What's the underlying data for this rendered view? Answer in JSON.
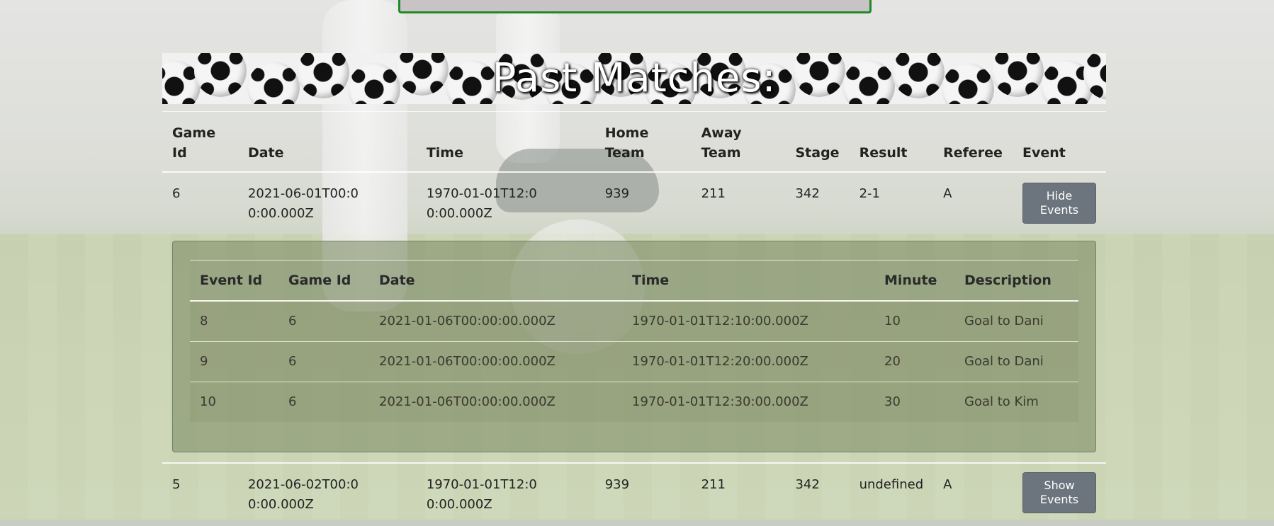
{
  "page": {
    "title": "Past Matches:"
  },
  "matches": {
    "headers": [
      "Game Id",
      "Date",
      "Time",
      "Home Team",
      "Away Team",
      "Stage",
      "Result",
      "Referee",
      "Event"
    ],
    "rows": [
      {
        "game_id": "6",
        "date": "2021-06-01T00:00:00.000Z",
        "time": "1970-01-01T12:00:00.000Z",
        "home_team": "939",
        "away_team": "211",
        "stage": "342",
        "result": "2-1",
        "referee": "A",
        "event_button": "Hide Events"
      },
      {
        "game_id": "5",
        "date": "2021-06-02T00:00:00.000Z",
        "time": "1970-01-01T12:00:00.000Z",
        "home_team": "939",
        "away_team": "211",
        "stage": "342",
        "result": "undefined",
        "referee": "A",
        "event_button": "Show Events"
      }
    ]
  },
  "events": {
    "headers": [
      "Event Id",
      "Game Id",
      "Date",
      "Time",
      "Minute",
      "Description"
    ],
    "rows": [
      {
        "event_id": "8",
        "game_id": "6",
        "date": "2021-01-06T00:00:00.000Z",
        "time": "1970-01-01T12:10:00.000Z",
        "minute": "10",
        "description": "Goal to Dani"
      },
      {
        "event_id": "9",
        "game_id": "6",
        "date": "2021-01-06T00:00:00.000Z",
        "time": "1970-01-01T12:20:00.000Z",
        "minute": "20",
        "description": "Goal to Dani"
      },
      {
        "event_id": "10",
        "game_id": "6",
        "date": "2021-01-06T00:00:00.000Z",
        "time": "1970-01-01T12:30:00.000Z",
        "minute": "30",
        "description": "Goal to Kim"
      }
    ]
  }
}
